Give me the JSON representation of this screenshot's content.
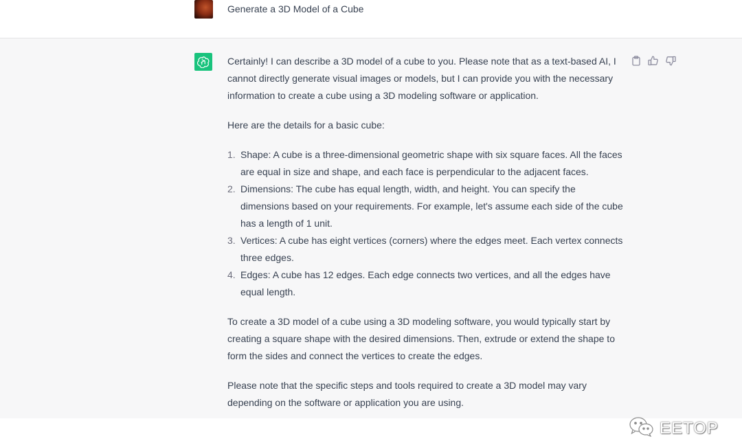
{
  "user": {
    "message": "Generate a 3D Model of a Cube"
  },
  "assistant": {
    "intro": "Certainly! I can describe a 3D model of a cube to you. Please note that as a text-based AI, I cannot directly generate visual images or models, but I can provide you with the necessary information to create a cube using a 3D modeling software or application.",
    "details_lead": "Here are the details for a basic cube:",
    "items": [
      {
        "num": "1.",
        "text": "Shape: A cube is a three-dimensional geometric shape with six square faces. All the faces are equal in size and shape, and each face is perpendicular to the adjacent faces."
      },
      {
        "num": "2.",
        "text": "Dimensions: The cube has equal length, width, and height. You can specify the dimensions based on your requirements. For example, let's assume each side of the cube has a length of 1 unit."
      },
      {
        "num": "3.",
        "text": "Vertices: A cube has eight vertices (corners) where the edges meet. Each vertex connects three edges."
      },
      {
        "num": "4.",
        "text": "Edges: A cube has 12 edges. Each edge connects two vertices, and all the edges have equal length."
      }
    ],
    "paragraph_create": "To create a 3D model of a cube using a 3D modeling software, you would typically start by creating a square shape with the desired dimensions. Then, extrude or extend the shape to form the sides and connect the vertices to create the edges.",
    "paragraph_note": "Please note that the specific steps and tools required to create a 3D model may vary depending on the software or application you are using."
  },
  "actions": {
    "copy_icon": "clipboard-icon",
    "like_icon": "thumbs-up-icon",
    "dislike_icon": "thumbs-down-icon"
  },
  "watermark": {
    "text": "EETOP",
    "icon": "wechat-icon"
  },
  "colors": {
    "assistant_bg": "#f7f7f8",
    "gpt_green": "#19c37d",
    "text": "#374151"
  }
}
